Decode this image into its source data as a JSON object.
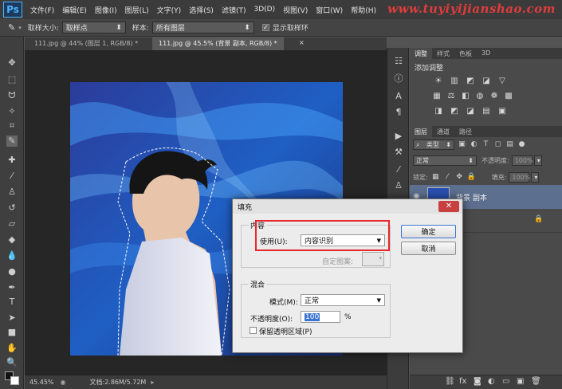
{
  "menubar": {
    "logo": "Ps",
    "items": [
      "文件(F)",
      "编辑(E)",
      "图像(I)",
      "图层(L)",
      "文字(Y)",
      "选择(S)",
      "滤镜(T)",
      "3D(D)",
      "视图(V)",
      "窗口(W)",
      "帮助(H)"
    ],
    "watermark": "www.tuyiyijianshao.com"
  },
  "options": {
    "sample_size_label": "取样大小:",
    "sample_size_value": "取样点",
    "sample_label": "样本:",
    "sample_value": "所有图层",
    "show_ring_label": "显示取样环",
    "show_ring_checked": true
  },
  "tabs": [
    {
      "label": "111.jpg @ 44% (图层 1, RGB/8) *",
      "active": false
    },
    {
      "label": "111.jpg @ 45.5% (背景 副本, RGB/8) *",
      "active": true
    }
  ],
  "status": {
    "zoom": "45.45%",
    "doc": "文档:2.86M/5.72M"
  },
  "panels": {
    "top_tabs": [
      "调整",
      "样式",
      "色板",
      "3D"
    ],
    "add_adjustment": "添加调整",
    "layer_tabs": [
      "图层",
      "通道",
      "路径"
    ],
    "kind_label": "类型",
    "blend_mode": "正常",
    "opacity_label": "不透明度:",
    "opacity_value": "100%",
    "lock_label": "锁定:",
    "fill_label": "填充:",
    "fill_value": "100%",
    "layer_name": "背景 副本"
  },
  "dialog": {
    "title": "填充",
    "contents_group": "内容",
    "use_label": "使用(U):",
    "use_value": "内容识别",
    "custom_pattern_label": "自定图案:",
    "blending_group": "混合",
    "mode_label": "模式(M):",
    "mode_value": "正常",
    "opacity_label": "不透明度(O):",
    "opacity_value": "100",
    "opacity_unit": "%",
    "preserve_label": "保留透明区域(P)",
    "ok_label": "确定",
    "cancel_label": "取消"
  },
  "colors": {
    "highlight": "#e8262c",
    "watermark": "#e03c3c",
    "background": "#535353"
  }
}
